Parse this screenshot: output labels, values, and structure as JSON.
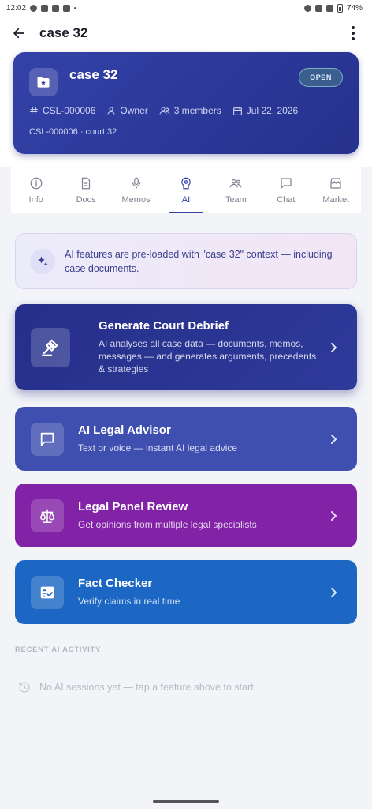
{
  "status_bar": {
    "time": "12:02",
    "battery": "74%"
  },
  "app_bar": {
    "title": "case 32"
  },
  "case_card": {
    "title": "case 32",
    "status": "OPEN",
    "case_id": "CSL-000006",
    "role": "Owner",
    "members": "3 members",
    "date": "Jul 22, 2026",
    "subtitle": "CSL-000006 · court 32"
  },
  "tabs": [
    {
      "label": "Info",
      "icon": "info-icon"
    },
    {
      "label": "Docs",
      "icon": "document-icon"
    },
    {
      "label": "Memos",
      "icon": "microphone-icon"
    },
    {
      "label": "AI",
      "icon": "brain-icon",
      "active": true
    },
    {
      "label": "Team",
      "icon": "team-icon"
    },
    {
      "label": "Chat",
      "icon": "chat-icon"
    },
    {
      "label": "Market",
      "icon": "store-icon"
    }
  ],
  "notice": {
    "text": "AI features are pre-loaded with \"case 32\" context — including case documents."
  },
  "features": [
    {
      "title": "Generate Court Debrief",
      "description": "AI analyses all case data — documents, memos, messages — and generates arguments, precedents & strategies",
      "icon": "gavel-icon",
      "color": "#262f8a"
    },
    {
      "title": "AI Legal Advisor",
      "description": "Text or voice — instant AI legal advice",
      "icon": "chat-bubble-icon",
      "color": "#3f4fb0"
    },
    {
      "title": "Legal Panel Review",
      "description": "Get opinions from multiple legal specialists",
      "icon": "scales-icon",
      "color": "#8222a6"
    },
    {
      "title": "Fact Checker",
      "description": "Verify claims in real time",
      "icon": "fact-check-icon",
      "color": "#1b67c3"
    }
  ],
  "recent": {
    "heading": "RECENT AI ACTIVITY",
    "empty_text": "No AI sessions yet — tap a feature above to start."
  }
}
